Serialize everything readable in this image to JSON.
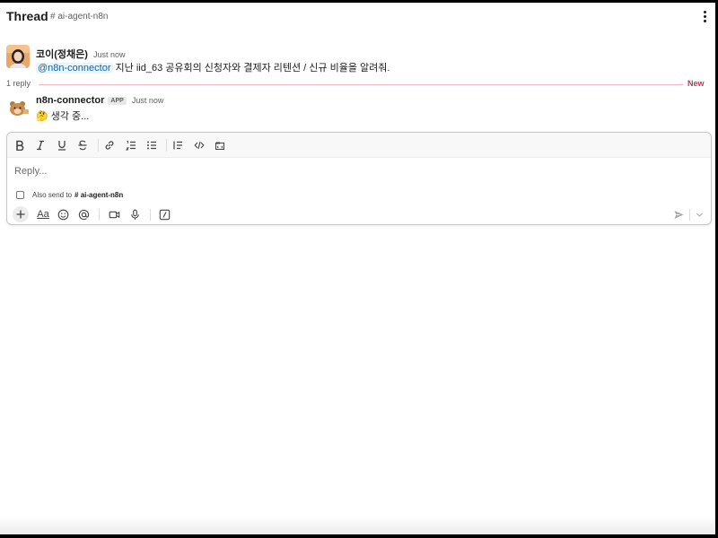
{
  "header": {
    "title": "Thread",
    "channel": "# ai-agent-n8n",
    "more_icon": "kebab-vertical-icon"
  },
  "messages": [
    {
      "sender": "코이(정채은)",
      "time": "Just now",
      "mention": "@n8n-connector",
      "text": " 지난 iid_63 공유회의 신청자와 결제자 리텐션 / 신규 비율을 알려줘.",
      "avatar_icon": "user-avatar"
    },
    {
      "sender": "n8n-connector",
      "badge": "APP",
      "time": "Just now",
      "emoji": "🤔",
      "text": " 생각 중...",
      "avatar_icon": "bear-avatar"
    }
  ],
  "replies": {
    "count_label": "1 reply",
    "new_label": "New",
    "new_color": "#c0325a"
  },
  "composer": {
    "placeholder": "Reply...",
    "also_send_label": "Also send to",
    "also_send_channel": "# ai-agent-n8n",
    "also_send_checked": false,
    "format_tools": [
      "bold-icon",
      "italic-icon",
      "underline-icon",
      "strikethrough-icon",
      "link-icon",
      "ordered-list-icon",
      "bulleted-list-icon",
      "blockquote-icon",
      "code-icon",
      "code-block-icon"
    ],
    "action_tools": [
      "plus-icon",
      "text-format-icon",
      "emoji-icon",
      "mention-icon",
      "video-icon",
      "microphone-icon",
      "slash-command-icon"
    ],
    "text_format_label": "Aa"
  },
  "colors": {
    "mention_text": "#1264a3",
    "mention_bg": "#e8f5fa"
  }
}
